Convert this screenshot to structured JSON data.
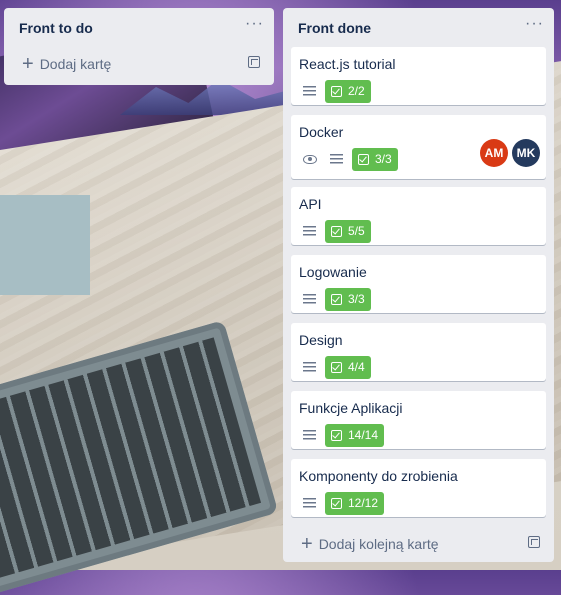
{
  "lists": [
    {
      "title": "Front to do",
      "add_label": "Dodaj kartę"
    },
    {
      "title": "Front done",
      "add_label": "Dodaj kolejną kartę",
      "cards": [
        {
          "title": "React.js tutorial",
          "checklist": "2/2"
        },
        {
          "title": "Docker",
          "checklist": "3/3",
          "members": [
            "AM",
            "MK"
          ]
        },
        {
          "title": "API",
          "checklist": "5/5"
        },
        {
          "title": "Logowanie",
          "checklist": "3/3"
        },
        {
          "title": "Design",
          "checklist": "4/4"
        },
        {
          "title": "Funkcje Aplikacji",
          "checklist": "14/14"
        },
        {
          "title": "Komponenty do zrobienia",
          "checklist": "12/12"
        }
      ]
    }
  ],
  "colors": {
    "list_bg": "#ebecf0",
    "checklist_complete": "#61bd4f",
    "avatar_am": "#d93a15",
    "avatar_mk": "#243a5e"
  },
  "icons": {
    "menu": "ellipsis-icon",
    "add": "plus-icon",
    "template": "card-template-icon",
    "description": "description-icon",
    "watch": "eye-icon",
    "checklist": "checklist-icon"
  },
  "menu_glyph": "···",
  "plus_glyph": "+"
}
